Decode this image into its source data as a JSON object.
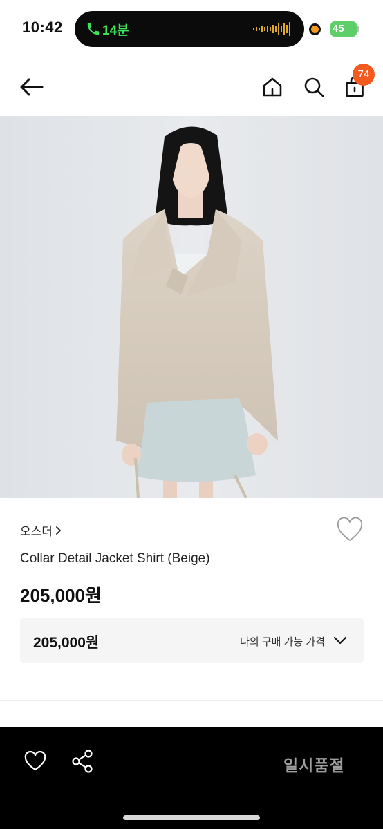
{
  "status_bar": {
    "time": "10:42",
    "call_duration": "14분",
    "battery": "45"
  },
  "nav": {
    "cart_count": "74"
  },
  "product": {
    "brand": "오스더",
    "title": "Collar Detail Jacket Shirt (Beige)",
    "price": "205,000원",
    "price_box": {
      "value": "205,000원",
      "label": "나의 구매 가능 가격"
    }
  },
  "bottom_bar": {
    "status_label": "일시품절"
  },
  "icons": {
    "back": "back-arrow-icon",
    "home": "home-icon",
    "search": "search-icon",
    "cart": "shopping-bag-icon",
    "wishlist": "heart-icon",
    "share": "share-icon",
    "expand": "chevron-down-icon"
  },
  "colors": {
    "badge": "#f45a1f",
    "call_green": "#3ee05c",
    "battery_green": "#5fce68",
    "bottom_bar": "#000000",
    "sold_out_text": "#9e9e9e"
  }
}
